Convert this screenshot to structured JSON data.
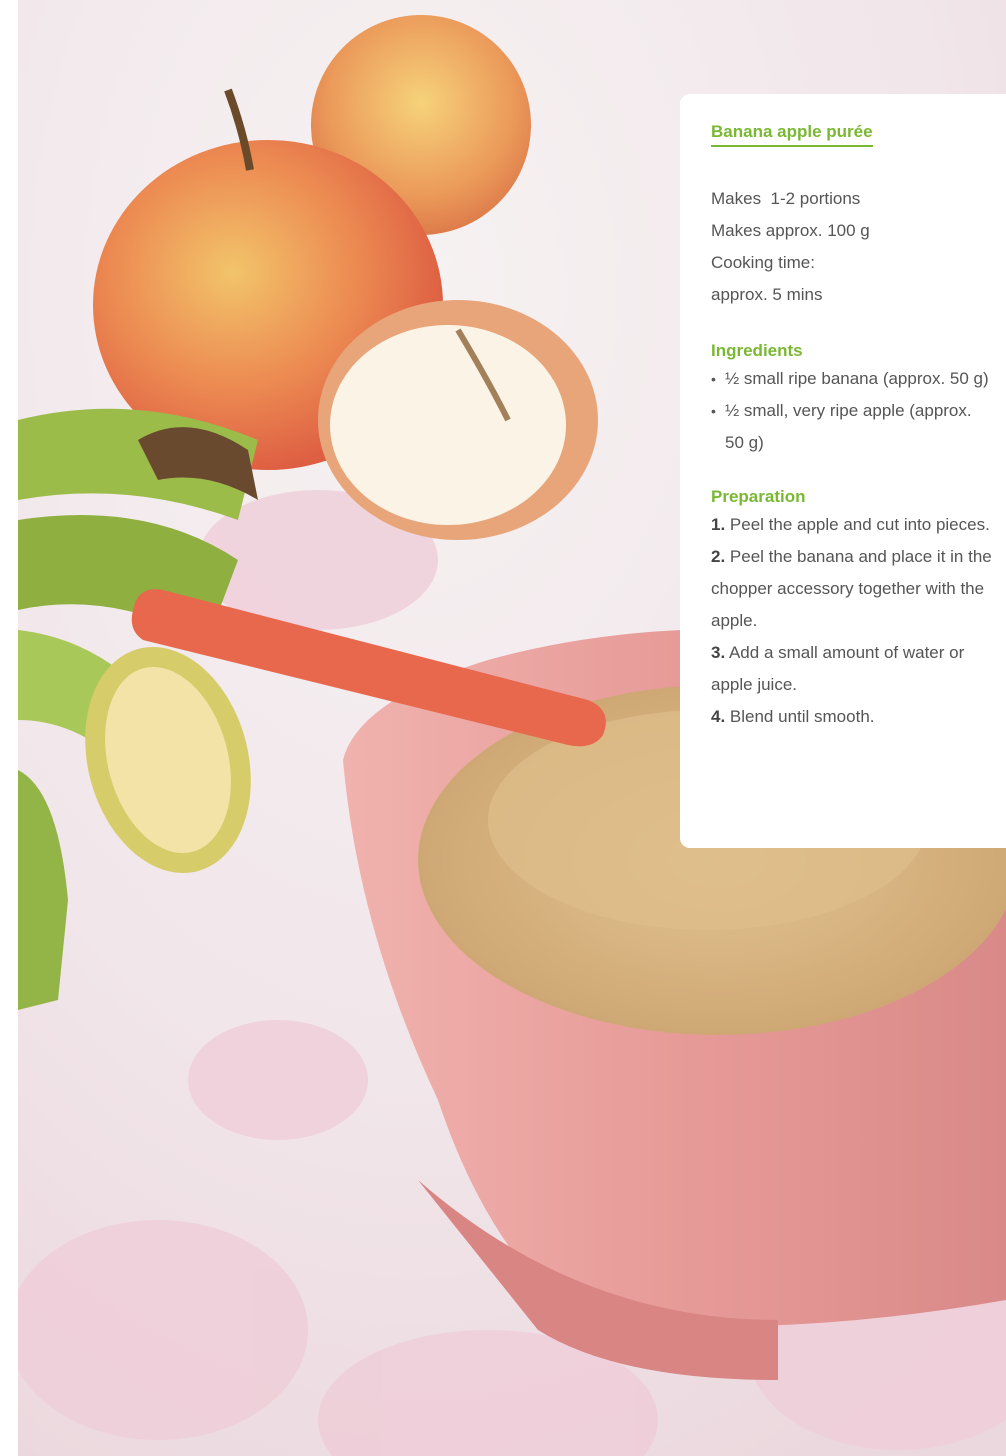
{
  "photo": {
    "alt": "Pink bowl of banana apple purée with orange spoon, apples and bananas",
    "colors": {
      "bowl": "#e8a3a1",
      "puree": "#d9b98a",
      "spoon": "#e8684d",
      "apple": "#e86a4c",
      "banana_peel": "#9cbc4a",
      "cloth": "#f3e6ec"
    }
  },
  "recipe": {
    "title": "Banana apple purée",
    "meta": [
      "Makes  1-2 portions",
      "Makes approx. 100 g",
      "Cooking time:",
      "approx. 5 mins"
    ],
    "ingredients_heading": "Ingredients",
    "ingredients": [
      "½ small ripe banana (approx. 50 g)",
      "½ small, very ripe apple (approx. 50 g)"
    ],
    "preparation_heading": "Preparation",
    "steps": [
      {
        "num": "1.",
        "text": " Peel the apple and cut into pieces."
      },
      {
        "num": "2.",
        "text": " Peel the banana and place it in the chopper accessory together with the apple."
      },
      {
        "num": "3.",
        "text": " Add a small amount of water or apple juice."
      },
      {
        "num": "4.",
        "text": " Blend until smooth."
      }
    ],
    "accent_color": "#7ab833"
  }
}
